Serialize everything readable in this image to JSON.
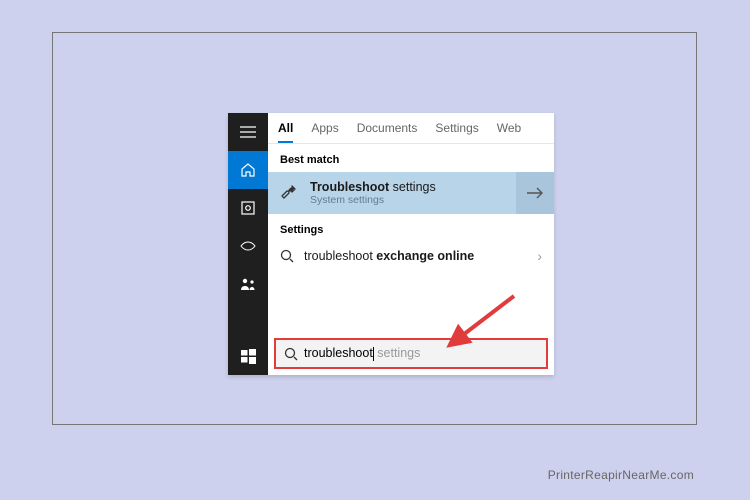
{
  "tabs": {
    "all": "All",
    "apps": "Apps",
    "documents": "Documents",
    "settings": "Settings",
    "web": "Web"
  },
  "sections": {
    "best_match": "Best match",
    "settings": "Settings"
  },
  "best_match": {
    "title_prefix": "Troubleshoot",
    "title_suffix": " settings",
    "subtitle": "System settings"
  },
  "settings_result": {
    "prefix": "troubleshoot ",
    "bold": "exchange online"
  },
  "search": {
    "typed": "troubleshoot",
    "ghost": " settings"
  },
  "watermark": "PrinterReapirNearMe.com"
}
